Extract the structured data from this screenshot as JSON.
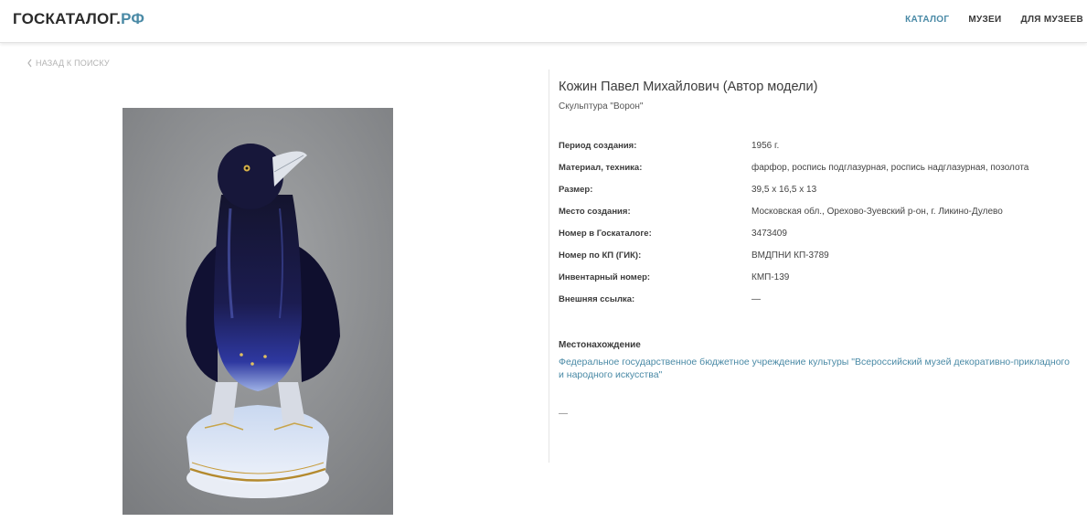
{
  "header": {
    "logo_main": "ГОСКАТАЛОГ.",
    "logo_tld": "РФ",
    "nav": [
      {
        "label": "КАТАЛОГ",
        "active": true
      },
      {
        "label": "МУЗЕИ",
        "active": false
      },
      {
        "label": "ДЛЯ МУЗЕЕВ",
        "active": false
      }
    ]
  },
  "back_link": "НАЗАД К ПОИСКУ",
  "item": {
    "author": "Кожин Павел Михайлович (Автор модели)",
    "title": "Скульптура \"Ворон\"",
    "properties": [
      {
        "label": "Период создания:",
        "value": "1956 г."
      },
      {
        "label": "Материал, техника:",
        "value": "фарфор, роспись подглазурная, роспись надглазурная, позолота"
      },
      {
        "label": "Размер:",
        "value": "39,5 х 16,5 х 13"
      },
      {
        "label": "Место создания:",
        "value": "Московская обл., Орехово-Зуевский р-он, г. Ликино-Дулево"
      },
      {
        "label": "Номер в Госкаталоге:",
        "value": "3473409"
      },
      {
        "label": "Номер по КП (ГИК):",
        "value": "ВМДПНИ КП-3789"
      },
      {
        "label": "Инвентарный номер:",
        "value": "КМП-139"
      },
      {
        "label": "Внешняя ссылка:",
        "value": "—"
      }
    ],
    "location_title": "Местонахождение",
    "location_link": "Федеральное государственное бюджетное учреждение культуры \"Всероссийский музей декоративно-прикладного и народного искусства\"",
    "footer_dash": "—"
  },
  "colors": {
    "accent": "#4a8aa6",
    "photo_bg": "#8a8c8e",
    "raven_body": "#121233",
    "cobalt": "#2b2f8a"
  },
  "icons": {
    "back": "chevron-left-icon"
  }
}
